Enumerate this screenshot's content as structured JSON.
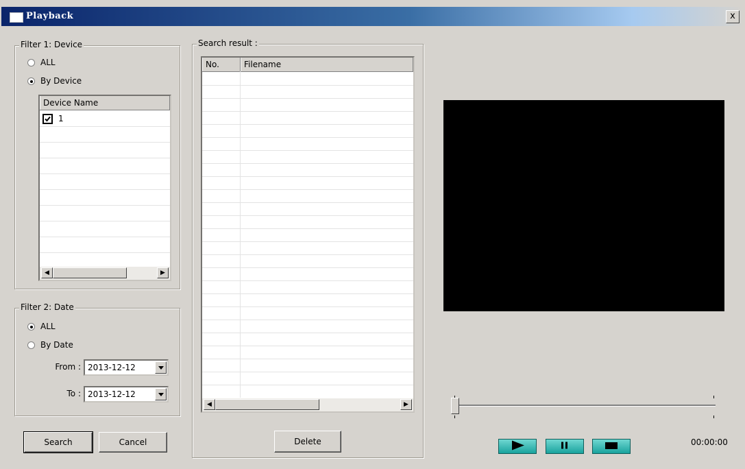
{
  "window": {
    "title": "Playback",
    "close_label": "x"
  },
  "filter_device": {
    "label": "Filter 1: Device",
    "radio_all": "ALL",
    "radio_by_device": "By Device",
    "selected": "By Device",
    "column_header": "Device Name",
    "devices": [
      {
        "name": "1",
        "checked": true
      }
    ]
  },
  "filter_date": {
    "label": "Filter 2: Date",
    "radio_all": "ALL",
    "radio_by_date": "By Date",
    "selected": "ALL",
    "from_label": "From :",
    "from_value": "2013-12-12",
    "to_label": "To :",
    "to_value": "2013-12-12"
  },
  "actions": {
    "search_label": "Search",
    "cancel_label": "Cancel"
  },
  "search_result": {
    "label": "Search result :",
    "col_no": "No.",
    "col_filename": "Filename",
    "rows": [],
    "delete_label": "Delete"
  },
  "player": {
    "progress": 0,
    "time": "00:00:00",
    "buttons": [
      "play-icon",
      "pause-icon",
      "stop-icon"
    ]
  },
  "colors": {
    "title_bar": "#0a246a",
    "window_bg": "#d6d3ce",
    "player_button": "#1aa39e",
    "video_bg": "#000000"
  }
}
